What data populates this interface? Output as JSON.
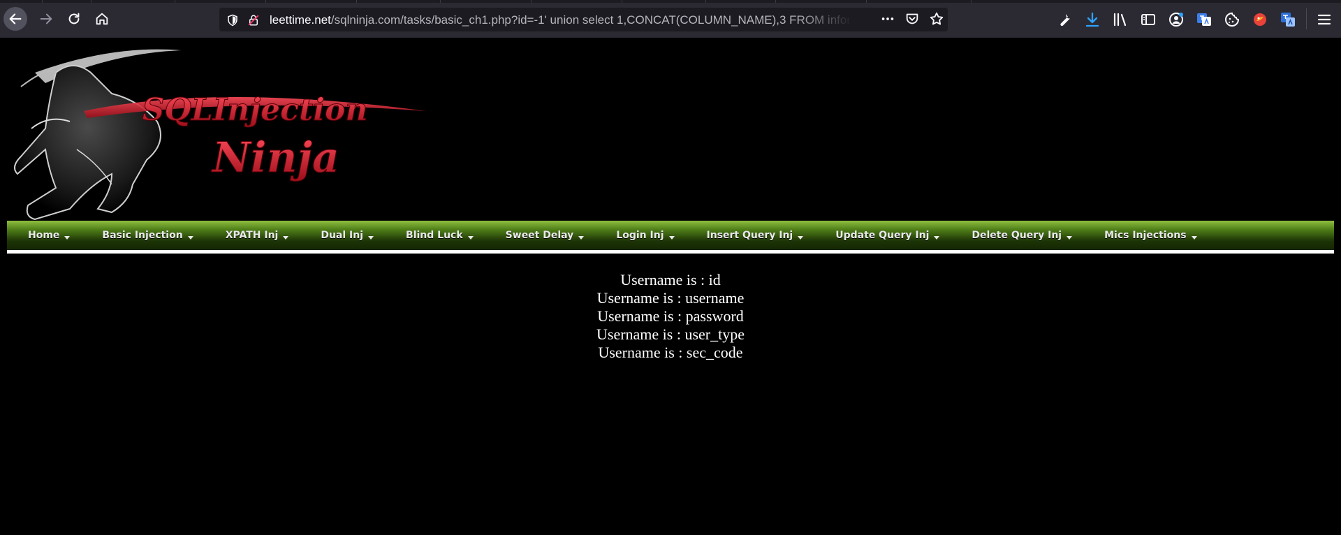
{
  "browser": {
    "url_host": "leettime.net",
    "url_path": "/sqlninja.com/tasks/basic_ch1.php?id=-1' union select 1,CONCAT(COLUMN_NAME),3 FROM infor",
    "icons": [
      "back-icon",
      "forward-icon",
      "reload-icon",
      "home-icon",
      "shield-icon",
      "insecure-lock-icon",
      "more-icon",
      "pocket-icon",
      "bookmark-star-icon",
      "wrench-icon",
      "download-icon",
      "library-icon",
      "sidebar-icon",
      "account-icon",
      "translate-icon",
      "cookie-icon",
      "extension-icon",
      "translate-alt-icon",
      "menu-icon"
    ]
  },
  "site": {
    "logo_line1": "SQLInjection",
    "logo_line2": "Ninja"
  },
  "nav": {
    "items": [
      {
        "label": "Home"
      },
      {
        "label": "Basic Injection"
      },
      {
        "label": "XPATH Inj"
      },
      {
        "label": "Dual Inj"
      },
      {
        "label": "Blind Luck"
      },
      {
        "label": "Sweet Delay"
      },
      {
        "label": "Login Inj"
      },
      {
        "label": "Insert Query Inj"
      },
      {
        "label": "Update Query Inj"
      },
      {
        "label": "Delete Query Inj"
      },
      {
        "label": "Mics Injections"
      }
    ]
  },
  "results": [
    "Username is : id",
    "Username is : username",
    "Username is : password",
    "Username is : user_type",
    "Username is : sec_code"
  ],
  "colors": {
    "toolbar_bg": "#2b2a33",
    "urlbar_bg": "#1c1b22",
    "page_bg": "#000000",
    "nav_green_top": "#8fbf3f",
    "nav_green_bottom": "#142602",
    "logo_red": "#d11a2a"
  }
}
